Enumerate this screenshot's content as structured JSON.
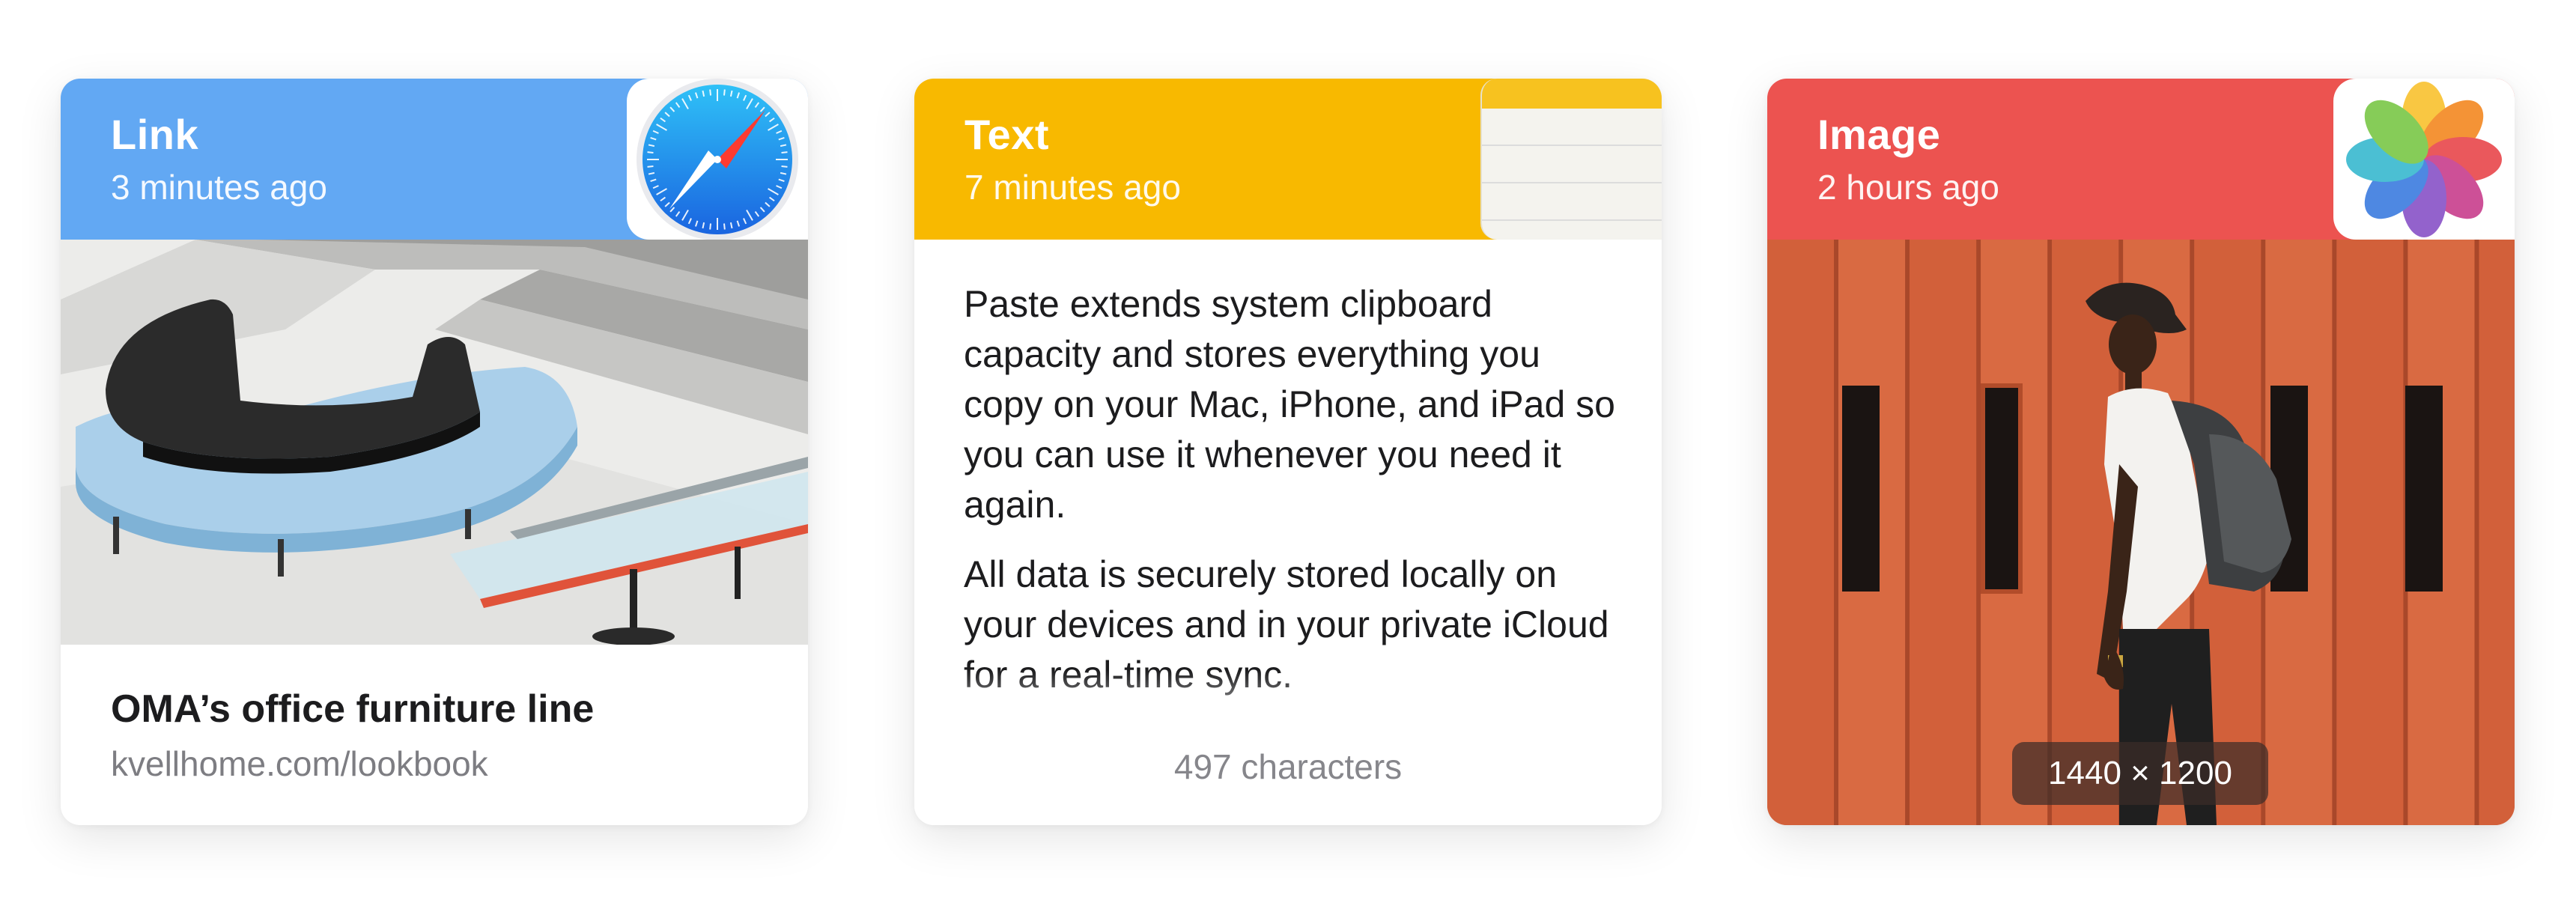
{
  "cards": {
    "link": {
      "type_label": "Link",
      "time": "3 minutes ago",
      "app_icon": "safari-icon",
      "title": "OMA’s office furniture line",
      "url": "kvellhome.com/lookbook",
      "accent": "#62a8f3"
    },
    "text": {
      "type_label": "Text",
      "time": "7 minutes ago",
      "app_icon": "notes-icon",
      "paragraph_1": "Paste extends system clipboard capacity and stores everything you copy on your Mac, iPhone, and iPad so you can use it whenever you need it again.",
      "paragraph_2": "All data is securely stored locally on your devices and in your private iCloud for a real-time sync.",
      "char_count": "497 characters",
      "accent": "#f8b900"
    },
    "image": {
      "type_label": "Image",
      "time": "2 hours ago",
      "app_icon": "photos-icon",
      "dimensions": "1440 × 1200",
      "accent": "#ec5350"
    }
  }
}
